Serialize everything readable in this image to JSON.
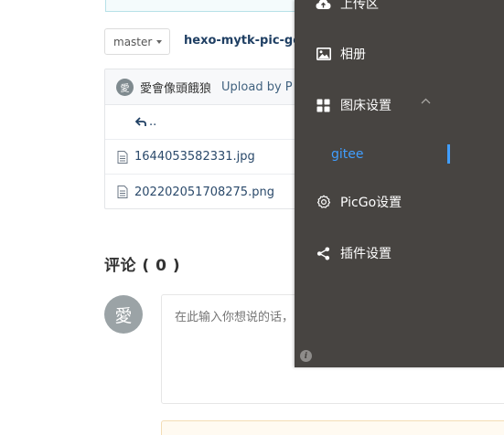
{
  "repo": {
    "branch": "master",
    "repo_name": "hexo-mytk-pic-go"
  },
  "commit": {
    "avatar_text": "愛",
    "author": "愛會像頭餓狼",
    "message": "Upload by P"
  },
  "files": {
    "back_label": "..",
    "items": [
      {
        "name": "1644053582331.jpg"
      },
      {
        "name": "202202051708275.png"
      }
    ]
  },
  "comments": {
    "heading": "评论 ( 0 )",
    "avatar_text": "愛",
    "placeholder": "在此输入你想说的话，"
  },
  "picgo_menu": {
    "items": [
      {
        "label": "上传区",
        "icon": "cloud-upload-icon"
      },
      {
        "label": "相册",
        "icon": "picture-icon"
      },
      {
        "label": "图床设置",
        "icon": "grid-icon",
        "expanded": true
      },
      {
        "label": "PicGo设置",
        "icon": "gear-icon"
      },
      {
        "label": "插件设置",
        "icon": "share-icon"
      }
    ],
    "sub_items": [
      {
        "label": "gitee",
        "active": true
      }
    ],
    "info_icon": "info-icon",
    "accent_color": "#409eff",
    "background_color": "#474441"
  }
}
